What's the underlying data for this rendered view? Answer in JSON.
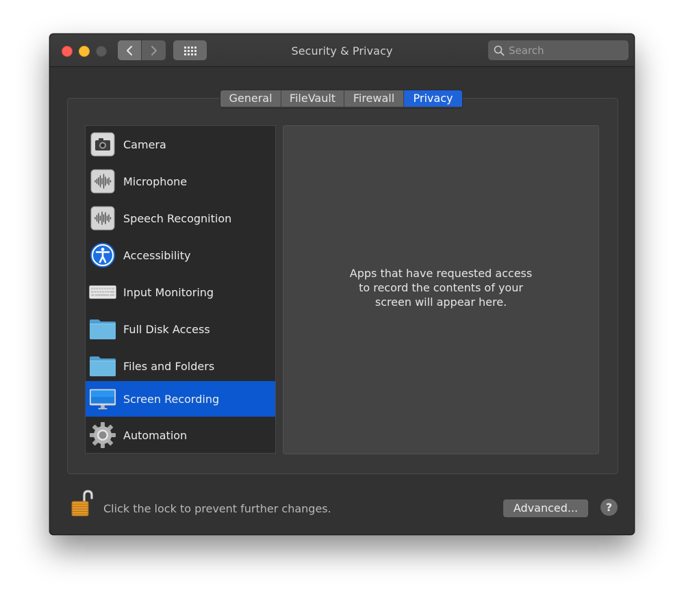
{
  "window": {
    "title": "Security & Privacy"
  },
  "toolbar": {
    "back_icon": "chevron-left-icon",
    "forward_icon": "chevron-right-icon",
    "show_all_icon": "grid-icon",
    "search_placeholder": "Search",
    "search_value": ""
  },
  "tabs": [
    {
      "label": "General",
      "selected": false
    },
    {
      "label": "FileVault",
      "selected": false
    },
    {
      "label": "Firewall",
      "selected": false
    },
    {
      "label": "Privacy",
      "selected": true
    }
  ],
  "privacy_categories": [
    {
      "label": "Camera",
      "icon": "camera-icon",
      "selected": false
    },
    {
      "label": "Microphone",
      "icon": "microphone-waveform-icon",
      "selected": false
    },
    {
      "label": "Speech Recognition",
      "icon": "speech-waveform-icon",
      "selected": false
    },
    {
      "label": "Accessibility",
      "icon": "accessibility-icon",
      "selected": false
    },
    {
      "label": "Input Monitoring",
      "icon": "keyboard-icon",
      "selected": false
    },
    {
      "label": "Full Disk Access",
      "icon": "folder-icon",
      "selected": false
    },
    {
      "label": "Files and Folders",
      "icon": "folder-icon",
      "selected": false
    },
    {
      "label": "Screen Recording",
      "icon": "display-icon",
      "selected": true
    },
    {
      "label": "Automation",
      "icon": "gear-icon",
      "selected": false
    }
  ],
  "detail": {
    "message": "Apps that have requested access\nto record the contents of your\nscreen will appear here."
  },
  "footer": {
    "lock_icon": "unlocked-padlock-icon",
    "lock_text": "Click the lock to prevent further changes.",
    "advanced_label": "Advanced...",
    "help_label": "?"
  },
  "colors": {
    "accent": "#0b58d0",
    "window_bg": "#323232",
    "close": "#fe5f57",
    "minimize": "#febc2e"
  }
}
